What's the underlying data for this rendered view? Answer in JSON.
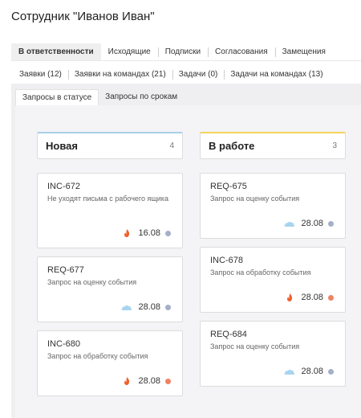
{
  "page": {
    "title": "Сотрудник \"Иванов Иван\""
  },
  "tabs_primary": [
    {
      "label": "В ответственности",
      "active": true
    },
    {
      "label": "Исходящие",
      "active": false
    },
    {
      "label": "Подписки",
      "active": false
    },
    {
      "label": "Согласования",
      "active": false
    },
    {
      "label": "Замещения",
      "active": false
    }
  ],
  "tabs_secondary": [
    {
      "label": "Заявки (12)"
    },
    {
      "label": "Заявки на командах (21)"
    },
    {
      "label": "Задачи (0)"
    },
    {
      "label": "Задачи на командах (13)"
    }
  ],
  "tabs_view": [
    {
      "label": "Запросы в статусе",
      "active": true
    },
    {
      "label": "Запросы по срокам",
      "active": false
    }
  ],
  "columns": [
    {
      "name": "Новая",
      "count": "4",
      "accent": "#a9cfe6",
      "cards": [
        {
          "id": "INC-672",
          "desc": "Не уходят письма с рабочего ящика",
          "icon": "fire-icon",
          "date": "16.08",
          "dot": "#a4b0c8"
        },
        {
          "id": "REQ-677",
          "desc": "Запрос на оценку события",
          "icon": "cloud-icon",
          "date": "28.08",
          "dot": "#a4b0c8"
        },
        {
          "id": "INC-680",
          "desc": "Запрос на обработку события",
          "icon": "fire-icon",
          "date": "28.08",
          "dot": "#ee8263"
        }
      ]
    },
    {
      "name": "В работе",
      "count": "3",
      "accent": "#f5d25b",
      "cards": [
        {
          "id": "REQ-675",
          "desc": "Запрос на оценку события",
          "icon": "cloud-icon",
          "date": "28.08",
          "dot": "#a4b0c8"
        },
        {
          "id": "INC-678",
          "desc": "Запрос на обработку события",
          "icon": "fire-icon",
          "date": "28.08",
          "dot": "#ee8263"
        },
        {
          "id": "REQ-684",
          "desc": "Запрос на оценку события",
          "icon": "cloud-icon",
          "date": "28.08",
          "dot": "#a4b0c8"
        }
      ]
    }
  ],
  "colors": {
    "fire": "#f0602a",
    "cloud": "#a9d4ef"
  }
}
